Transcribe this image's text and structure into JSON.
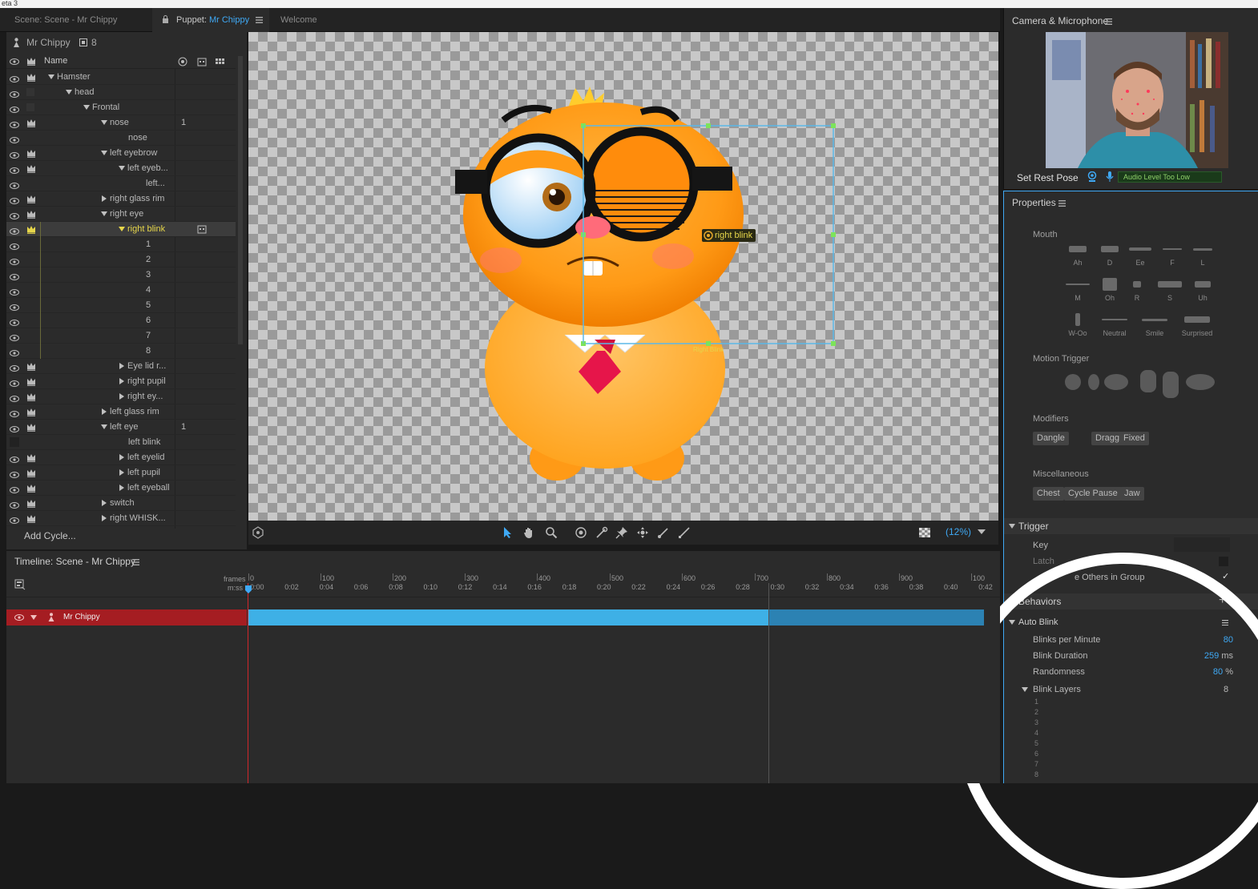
{
  "top_strip": "eta 3",
  "tabs": {
    "scene": "Scene: Scene - Mr Chippy",
    "puppet_prefix": "Puppet:",
    "puppet_name": "Mr Chippy",
    "welcome": "Welcome"
  },
  "puppet_panel": {
    "title": "Mr Chippy",
    "count": "8",
    "name_col": "Name",
    "add_cycle": "Add Cycle..."
  },
  "layers": [
    {
      "label": "Hamster",
      "count": ""
    },
    {
      "label": "head",
      "count": ""
    },
    {
      "label": "Frontal",
      "count": ""
    },
    {
      "label": "nose",
      "count": "1"
    },
    {
      "label": "nose",
      "count": ""
    },
    {
      "label": "left eyebrow",
      "count": ""
    },
    {
      "label": "left eyeb...",
      "count": ""
    },
    {
      "label": "left...",
      "count": ""
    },
    {
      "label": "right glass rim",
      "count": ""
    },
    {
      "label": "right eye",
      "count": ""
    },
    {
      "label": "right blink",
      "count": ""
    },
    {
      "label": "1",
      "count": ""
    },
    {
      "label": "2",
      "count": ""
    },
    {
      "label": "3",
      "count": ""
    },
    {
      "label": "4",
      "count": ""
    },
    {
      "label": "5",
      "count": ""
    },
    {
      "label": "6",
      "count": ""
    },
    {
      "label": "7",
      "count": ""
    },
    {
      "label": "8",
      "count": ""
    },
    {
      "label": "Eye lid r...",
      "count": ""
    },
    {
      "label": "right pupil",
      "count": ""
    },
    {
      "label": "right ey...",
      "count": ""
    },
    {
      "label": "left glass rim",
      "count": ""
    },
    {
      "label": "left eye",
      "count": "1"
    },
    {
      "label": "left blink",
      "count": ""
    },
    {
      "label": "left eyelid",
      "count": ""
    },
    {
      "label": "left pupil",
      "count": ""
    },
    {
      "label": "left eyeball",
      "count": ""
    },
    {
      "label": "switch",
      "count": ""
    },
    {
      "label": "right WHISK...",
      "count": ""
    }
  ],
  "stage": {
    "handle_label": "right blink",
    "handle_label_small": "Right Blink",
    "zoom": "(12%)"
  },
  "camera": {
    "title": "Camera & Microphone",
    "set_rest_pose": "Set Rest Pose",
    "audio_status": "Audio Level Too Low"
  },
  "properties": {
    "title": "Properties",
    "mouth_title": "Mouth",
    "visemes": [
      "Ah",
      "D",
      "Ee",
      "F",
      "L",
      "M",
      "Oh",
      "R",
      "S",
      "Uh",
      "W-Oo",
      "Neutral",
      "Smile",
      "Surprised"
    ],
    "motion_trigger_title": "Motion Trigger",
    "modifiers_title": "Modifiers",
    "modifiers": [
      "Dangle",
      "Draggable",
      "Fixed"
    ],
    "misc_title": "Miscellaneous",
    "misc": [
      "Chest",
      "Cycle Pause",
      "Jaw"
    ],
    "trigger_title": "Trigger",
    "key_label": "Key",
    "latch_label": "Latch",
    "hide_others": "e Others in Group",
    "behaviors_title": "Behaviors",
    "auto_blink_title": "Auto Blink",
    "blinks_per_minute_label": "Blinks per Minute",
    "blinks_per_minute": "80",
    "blink_duration_label": "Blink Duration",
    "blink_duration": "259",
    "blink_duration_unit": "ms",
    "randomness_label": "Randomness",
    "randomness": "80",
    "randomness_unit": "%",
    "blink_layers_label": "Blink Layers",
    "blink_layers_count": "8",
    "blink_layer_items": [
      "1",
      "2",
      "3",
      "4",
      "5",
      "6",
      "7",
      "8"
    ]
  },
  "timeline": {
    "title": "Timeline: Scene - Mr Chippy",
    "frames_label": "frames",
    "mss_label": "m:ss",
    "frame_ticks": [
      "0",
      "100",
      "200",
      "300",
      "400",
      "500",
      "600",
      "700",
      "800",
      "900",
      "100"
    ],
    "time_ticks": [
      "0:00",
      "0:02",
      "0:04",
      "0:06",
      "0:08",
      "0:10",
      "0:12",
      "0:14",
      "0:16",
      "0:18",
      "0:20",
      "0:22",
      "0:24",
      "0:26",
      "0:28",
      "0:30",
      "0:32",
      "0:34",
      "0:36",
      "0:38",
      "0:40",
      "0:42"
    ],
    "track_name": "Mr Chippy"
  },
  "colors": {
    "accent": "#3fa9f5",
    "selection_text": "#e6d64a",
    "track_bar": "#3eb0e6",
    "track_header": "#a51d22"
  }
}
